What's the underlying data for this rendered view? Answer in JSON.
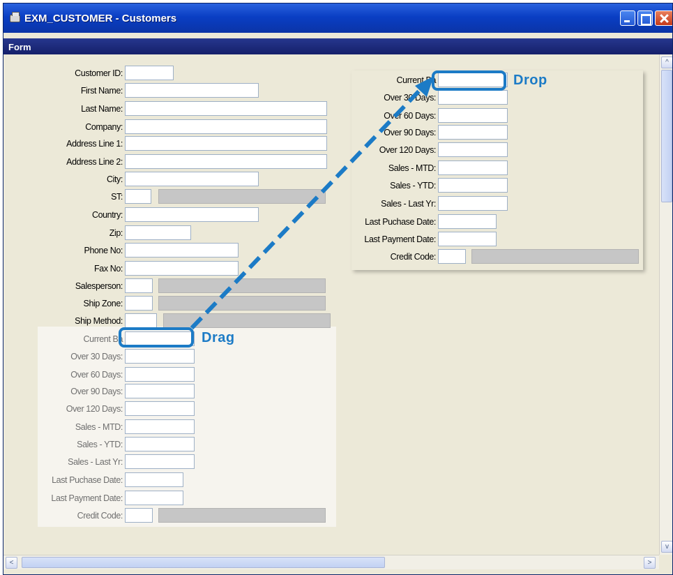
{
  "window": {
    "title": "EXM_CUSTOMER - Customers",
    "form_label": "Form",
    "buttons": [
      "minimize",
      "maximize",
      "close"
    ]
  },
  "customer_fields": [
    {
      "label": "Customer ID:",
      "has_lookup": false
    },
    {
      "label": "First Name:",
      "has_lookup": false
    },
    {
      "label": "Last Name:",
      "has_lookup": false
    },
    {
      "label": "Company:",
      "has_lookup": false
    },
    {
      "label": "Address Line 1:",
      "has_lookup": false
    },
    {
      "label": "Address Line 2:",
      "has_lookup": false
    },
    {
      "label": "City:",
      "has_lookup": false
    },
    {
      "label": "ST:",
      "has_lookup": true
    },
    {
      "label": "Country:",
      "has_lookup": false
    },
    {
      "label": "Zip:",
      "has_lookup": false
    },
    {
      "label": "Phone No:",
      "has_lookup": false
    },
    {
      "label": "Fax No:",
      "has_lookup": false
    },
    {
      "label": "Salesperson:",
      "has_lookup": true
    },
    {
      "label": "Ship Zone:",
      "has_lookup": true
    },
    {
      "label": "Ship Method:",
      "has_lookup": true
    }
  ],
  "balance_fields_source": [
    {
      "label": "Current Ba"
    },
    {
      "label": "Over 30 Days:"
    },
    {
      "label": "Over 60 Days:"
    },
    {
      "label": "Over 90 Days:"
    },
    {
      "label": "Over 120 Days:"
    },
    {
      "label": "Sales - MTD:"
    },
    {
      "label": "Sales - YTD:"
    },
    {
      "label": "Sales - Last Yr:"
    },
    {
      "label": "Last Puchase Date:"
    },
    {
      "label": "Last Payment Date:"
    },
    {
      "label": "Credit Code:"
    }
  ],
  "balance_fields_target": [
    {
      "label": "Current Ba"
    },
    {
      "label": "Over 30 Days:"
    },
    {
      "label": "Over 60 Days:"
    },
    {
      "label": "Over 90 Days:"
    },
    {
      "label": "Over 120 Days:"
    },
    {
      "label": "Sales - MTD:"
    },
    {
      "label": "Sales - YTD:"
    },
    {
      "label": "Sales - Last Yr:"
    },
    {
      "label": "Last Puchase Date:"
    },
    {
      "label": "Last Payment Date:"
    },
    {
      "label": "Credit Code:"
    }
  ],
  "annotations": {
    "drag_label": "Drag",
    "drop_label": "Drop",
    "color": "#1c7bc6"
  },
  "scrollbars": {
    "vertical_arrows": [
      "^",
      "v"
    ],
    "horizontal_arrows": [
      "<",
      ">"
    ]
  }
}
